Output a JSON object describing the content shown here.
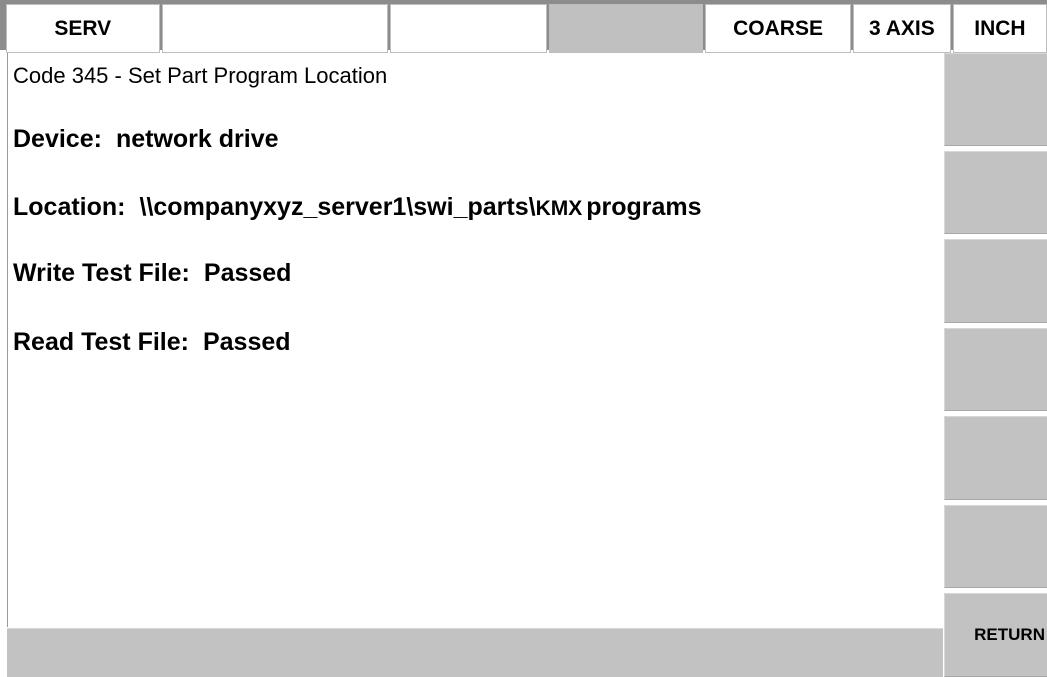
{
  "topbar": {
    "mode": "SERV",
    "cell2": "",
    "cell3": "",
    "cell4": "",
    "speed": "COARSE",
    "axis": "3 AXIS",
    "units": "INCH"
  },
  "main": {
    "code_title": "Code 345 - Set Part Program Location",
    "device_label": "Device:",
    "device_value": "network drive",
    "location_label": "Location:",
    "location_path": "\\\\companyxyz_server1\\swi_parts\\",
    "location_kmx": "KMX",
    "location_suffix": "programs",
    "write_label": "Write Test File:",
    "write_value": "Passed",
    "read_label": "Read Test File:",
    "read_value": "Passed"
  },
  "softkeys": {
    "k1": "",
    "k2": "",
    "k3": "",
    "k4": "",
    "k5": "",
    "k6": "",
    "return_label": "RETURN"
  },
  "bottombar": {
    "prompt": ""
  }
}
